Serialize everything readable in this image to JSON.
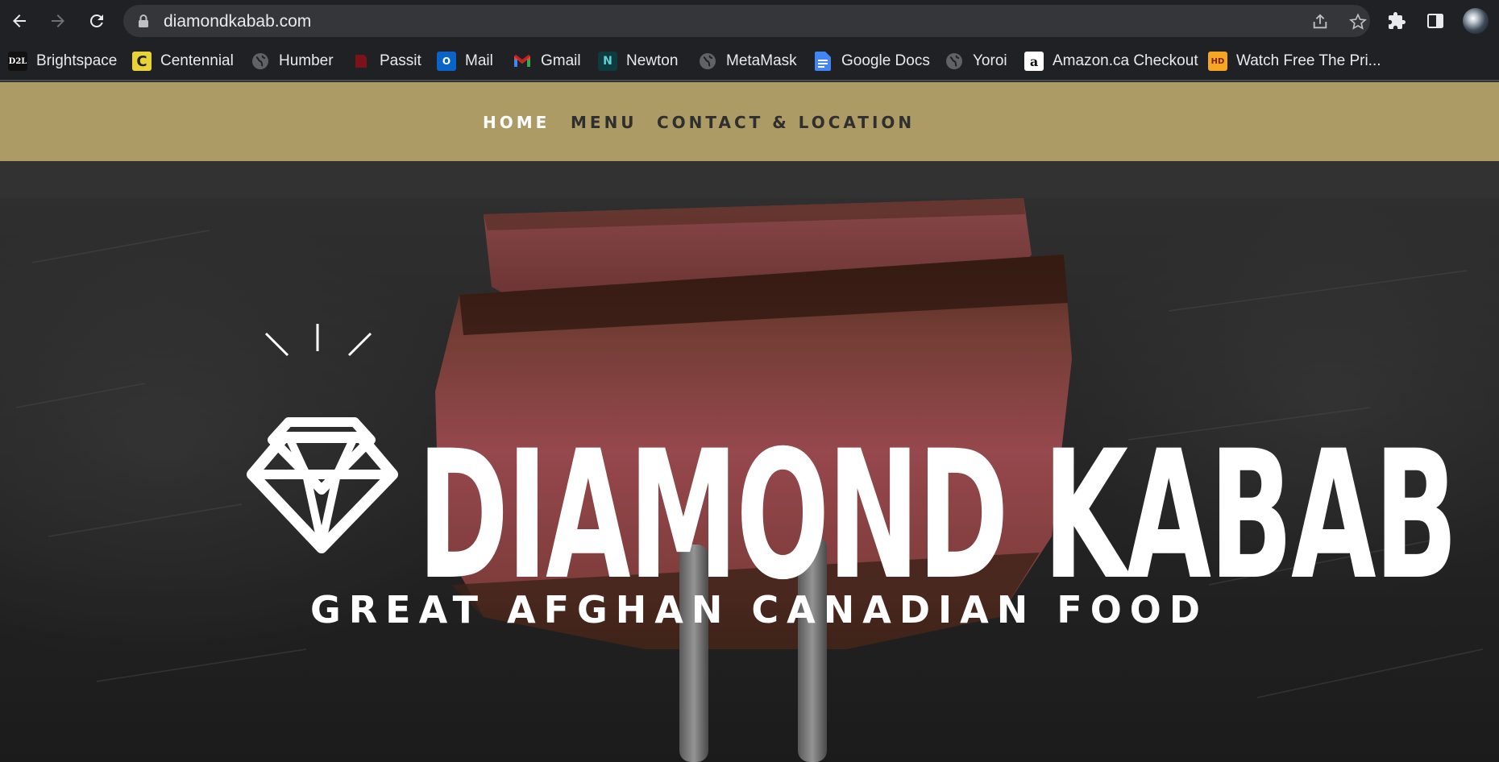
{
  "browser": {
    "url": "diamondkabab.com",
    "bookmarks": [
      {
        "label": "Brightspace",
        "icon": "d2l-icon",
        "fav": "D2L"
      },
      {
        "label": "Centennial",
        "icon": "centennial-icon",
        "fav": "C"
      },
      {
        "label": "Humber",
        "icon": "globe-icon",
        "fav": ""
      },
      {
        "label": "Passit",
        "icon": "passit-icon",
        "fav": ""
      },
      {
        "label": "Mail",
        "icon": "outlook-icon",
        "fav": "O"
      },
      {
        "label": "Gmail",
        "icon": "gmail-icon",
        "fav": "M"
      },
      {
        "label": "Newton",
        "icon": "newton-icon",
        "fav": "N"
      },
      {
        "label": "MetaMask",
        "icon": "globe-icon",
        "fav": ""
      },
      {
        "label": "Google Docs",
        "icon": "google-docs-icon",
        "fav": ""
      },
      {
        "label": "Yoroi",
        "icon": "globe-icon",
        "fav": ""
      },
      {
        "label": "Amazon.ca Checkout",
        "icon": "amazon-icon",
        "fav": "a"
      },
      {
        "label": "Watch Free The Pri...",
        "icon": "hd-icon",
        "fav": "HD"
      }
    ]
  },
  "site": {
    "nav": {
      "home": "HOME",
      "menu": "MENU",
      "contact": "CONTACT & LOCATION"
    },
    "hero": {
      "brand": "DIAMOND KABAB",
      "tagline": "GREAT AFGHAN CANADIAN FOOD"
    }
  },
  "colors": {
    "nav_background": "#ac9b64",
    "subbar": "#323232",
    "browser_chrome": "#202124"
  }
}
